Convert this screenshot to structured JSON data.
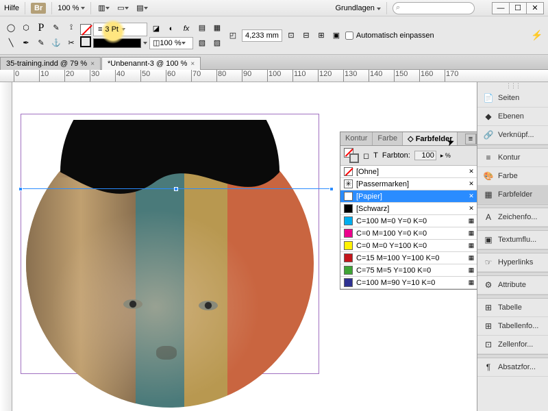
{
  "top": {
    "help": "Hilfe",
    "bridge": "Br",
    "zoom": "100 %",
    "workspace": "Grundlagen"
  },
  "toolbar": {
    "stroke_weight": "3 Pt",
    "scale": "100 %",
    "size_mm": "4,233 mm",
    "auto_fit": "Automatisch einpassen"
  },
  "tabs": [
    {
      "label": "35-training.indd @ 79 %",
      "active": false
    },
    {
      "label": "*Unbenannt-3 @ 100 %",
      "active": true
    }
  ],
  "ruler_marks": [
    "0",
    "10",
    "20",
    "30",
    "40",
    "50",
    "60",
    "70",
    "80",
    "90",
    "100",
    "110",
    "120",
    "130",
    "140",
    "150",
    "160",
    "170"
  ],
  "swatches": {
    "tabs": {
      "kontur": "Kontur",
      "farbe": "Farbe",
      "farbfelder": "Farbfelder"
    },
    "tint_label": "Farbton:",
    "tint_value": "100",
    "rows": [
      {
        "name": "[Ohne]",
        "type": "none",
        "chip": "nofill"
      },
      {
        "name": "[Passermarken]",
        "type": "reg",
        "chip": "registration",
        "color": "#000"
      },
      {
        "name": "[Papier]",
        "type": "paper",
        "chip": "#ffffff",
        "selected": true
      },
      {
        "name": "[Schwarz]",
        "type": "black",
        "chip": "#000000"
      },
      {
        "name": "C=100 M=0 Y=0 K=0",
        "chip": "#00aeef"
      },
      {
        "name": "C=0 M=100 Y=0 K=0",
        "chip": "#ec008c"
      },
      {
        "name": "C=0 M=0 Y=100 K=0",
        "chip": "#fff200"
      },
      {
        "name": "C=15 M=100 Y=100 K=0",
        "chip": "#c4161c"
      },
      {
        "name": "C=75 M=5 Y=100 K=0",
        "chip": "#3fa535"
      },
      {
        "name": "C=100 M=90 Y=10 K=0",
        "chip": "#2e3192"
      }
    ]
  },
  "dock": [
    {
      "label": "Seiten",
      "icon": "📄"
    },
    {
      "label": "Ebenen",
      "icon": "◆"
    },
    {
      "label": "Verknüpf...",
      "icon": "🔗"
    },
    {
      "sep": true
    },
    {
      "label": "Kontur",
      "icon": "≡"
    },
    {
      "label": "Farbe",
      "icon": "🎨"
    },
    {
      "label": "Farbfelder",
      "icon": "▦",
      "selected": true
    },
    {
      "sep": true
    },
    {
      "label": "Zeichenfo...",
      "icon": "A"
    },
    {
      "sep": true
    },
    {
      "label": "Textumflu...",
      "icon": "▣"
    },
    {
      "sep": true
    },
    {
      "label": "Hyperlinks",
      "icon": "☞"
    },
    {
      "sep": true
    },
    {
      "label": "Attribute",
      "icon": "⚙"
    },
    {
      "sep": true
    },
    {
      "label": "Tabelle",
      "icon": "⊞"
    },
    {
      "label": "Tabellenfo...",
      "icon": "⊞"
    },
    {
      "label": "Zellenfor...",
      "icon": "⊡"
    },
    {
      "sep": true
    },
    {
      "label": "Absatzfor...",
      "icon": "¶"
    }
  ]
}
